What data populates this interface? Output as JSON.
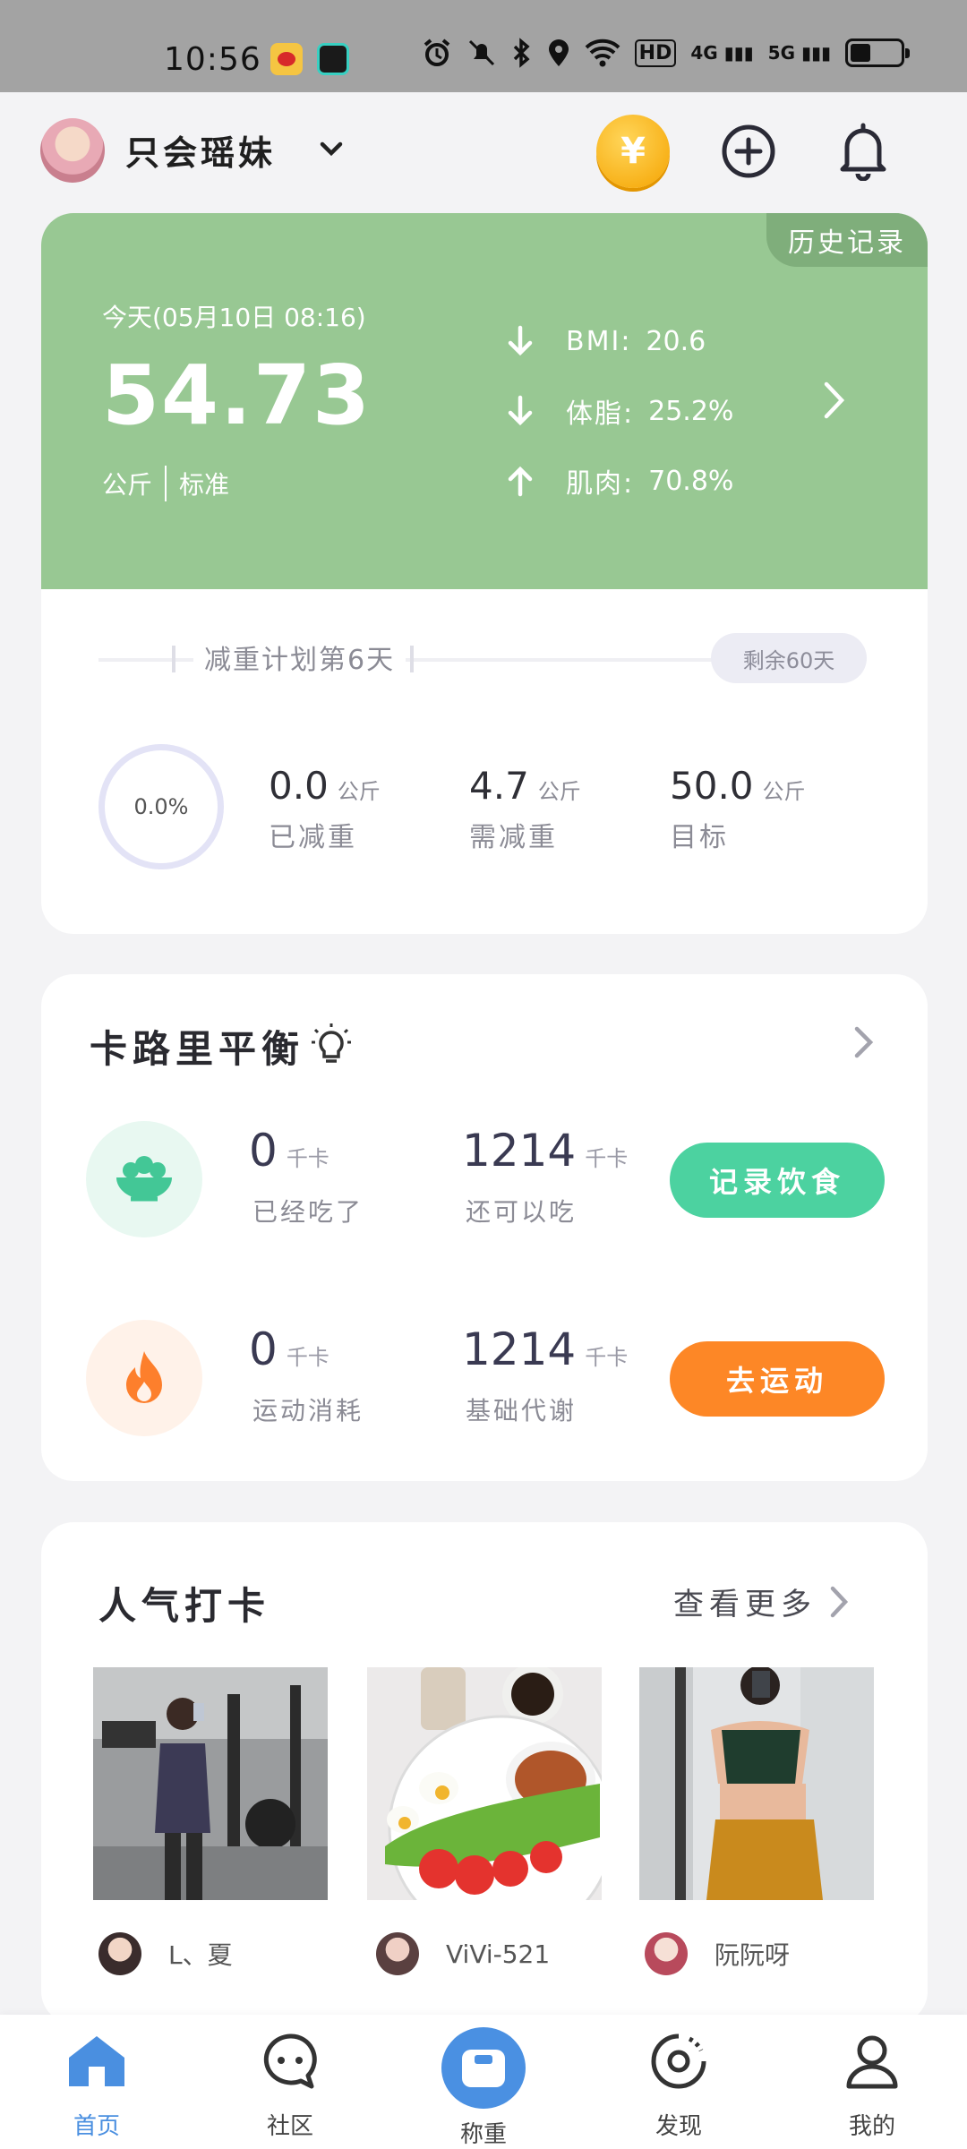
{
  "status_bar": {
    "time": "10:56",
    "badge": "HD",
    "signal_1": "4G",
    "signal_2": "5G"
  },
  "header": {
    "username": "只会瑶妹",
    "coin_symbol": "¥"
  },
  "weight_card": {
    "history_label": "历史记录",
    "date": "今天(05月10日 08:16)",
    "weight": "54.73",
    "unit": "公斤",
    "status": "标准",
    "metrics": [
      {
        "label": "BMI:",
        "value": "20.6",
        "trend": "down"
      },
      {
        "label": "体脂:",
        "value": "25.2%",
        "trend": "down"
      },
      {
        "label": "肌肉:",
        "value": "70.8%",
        "trend": "up"
      }
    ],
    "plan_label": "减重计划第6天",
    "remaining": "剩余60天",
    "progress": "0.0%",
    "stats": [
      {
        "value": "0.0",
        "unit": "公斤",
        "label": "已减重"
      },
      {
        "value": "4.7",
        "unit": "公斤",
        "label": "需减重"
      },
      {
        "value": "50.0",
        "unit": "公斤",
        "label": "目标"
      }
    ]
  },
  "calorie_card": {
    "title": "卡路里平衡",
    "rows": [
      {
        "left_value": "0",
        "left_unit": "千卡",
        "left_label": "已经吃了",
        "right_value": "1214",
        "right_unit": "千卡",
        "right_label": "还可以吃",
        "button": "记录饮食",
        "button_color": "#4cd2a0"
      },
      {
        "left_value": "0",
        "left_unit": "千卡",
        "left_label": "运动消耗",
        "right_value": "1214",
        "right_unit": "千卡",
        "right_label": "基础代谢",
        "button": "去运动",
        "button_color": "#fd8726"
      }
    ]
  },
  "popular": {
    "title": "人气打卡",
    "more": "查看更多",
    "posts": [
      {
        "user": "L、夏"
      },
      {
        "user": "ViVi-521"
      },
      {
        "user": "阮阮呀"
      }
    ]
  },
  "tabbar": {
    "items": [
      {
        "label": "首页",
        "icon": "home-icon",
        "active": true
      },
      {
        "label": "社区",
        "icon": "chat-icon"
      },
      {
        "label": "称重",
        "icon": "scale-icon"
      },
      {
        "label": "发现",
        "icon": "discover-icon"
      },
      {
        "label": "我的",
        "icon": "profile-icon"
      }
    ],
    "accent": "#4a8fe0"
  }
}
